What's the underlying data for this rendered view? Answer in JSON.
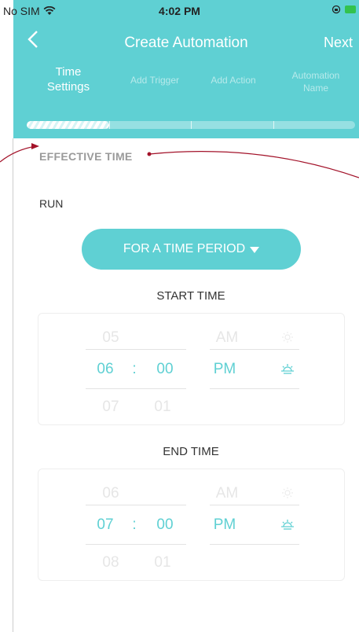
{
  "status_bar": {
    "carrier": "No SIM",
    "time": "4:02 PM"
  },
  "nav": {
    "back_icon": "chevron-left-icon",
    "title": "Create Automation",
    "next_label": "Next"
  },
  "steps": [
    {
      "line1": "Time",
      "line2": "Settings"
    },
    {
      "line1": "Add Trigger"
    },
    {
      "line1": "Add Action"
    },
    {
      "line1": "Automation",
      "line2": "Name"
    }
  ],
  "progress": {
    "current_step": 1,
    "total_steps": 4
  },
  "section_title": "EFFECTIVE TIME",
  "run_label": "RUN",
  "period_button": {
    "label": "FOR A TIME PERIOD"
  },
  "start": {
    "label": "START TIME",
    "hour_prev": "05",
    "hour": "06",
    "hour_next": "07",
    "minute": "00",
    "minute_next": "01",
    "ampm_prev": "AM",
    "ampm": "PM",
    "separator": ":"
  },
  "end": {
    "label": "END TIME",
    "hour_prev": "06",
    "hour": "07",
    "hour_next": "08",
    "minute": "00",
    "minute_next": "01",
    "ampm_prev": "AM",
    "ampm": "PM",
    "separator": ":"
  },
  "colors": {
    "accent": "#5fd0d3",
    "annotation": "#a3132a"
  }
}
